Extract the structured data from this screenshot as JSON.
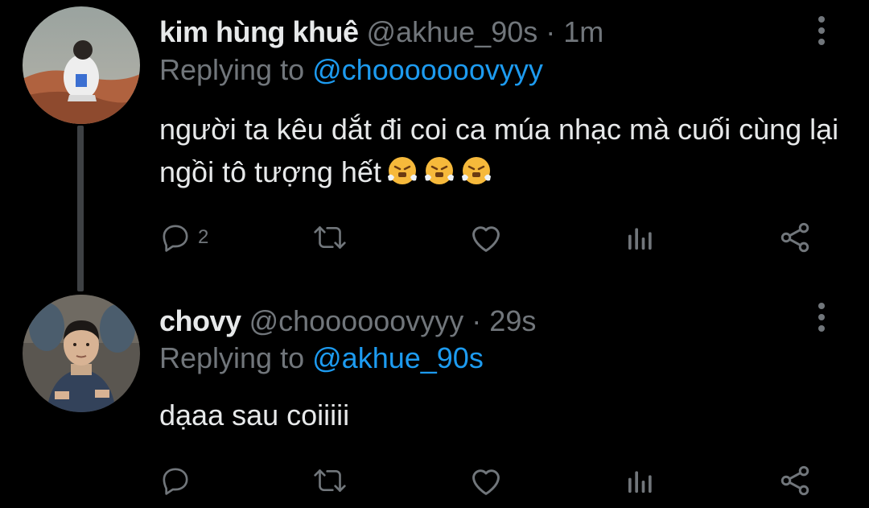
{
  "tweets": [
    {
      "name": "kim hùng khuê",
      "handle": "@akhue_90s",
      "time": "1m",
      "reply_prefix": "Replying to",
      "reply_to": "@chooooooovyyy",
      "text": "người ta kêu dắt đi coi ca múa nhạc mà cuối cùng lại ngồi tô tượng hết",
      "emoji": [
        "huffing-face-emoji",
        "huffing-face-emoji",
        "huffing-face-emoji"
      ],
      "reply_count": "2",
      "has_thread_line": true
    },
    {
      "name": "chovy",
      "handle": "@choooooovyyy",
      "time": "29s",
      "reply_prefix": "Replying to",
      "reply_to": "@akhue_90s",
      "text": "dạaa sau coiiiii",
      "reply_count": ""
    }
  ],
  "separator": "·",
  "colors": {
    "background": "#000000",
    "text_primary": "#e7e9ea",
    "text_secondary": "#71767b",
    "accent": "#1d9bf0",
    "thread_line": "#3e4144"
  },
  "icons": [
    "reply-icon",
    "retweet-icon",
    "like-icon",
    "views-icon",
    "share-icon",
    "more-options-icon"
  ]
}
